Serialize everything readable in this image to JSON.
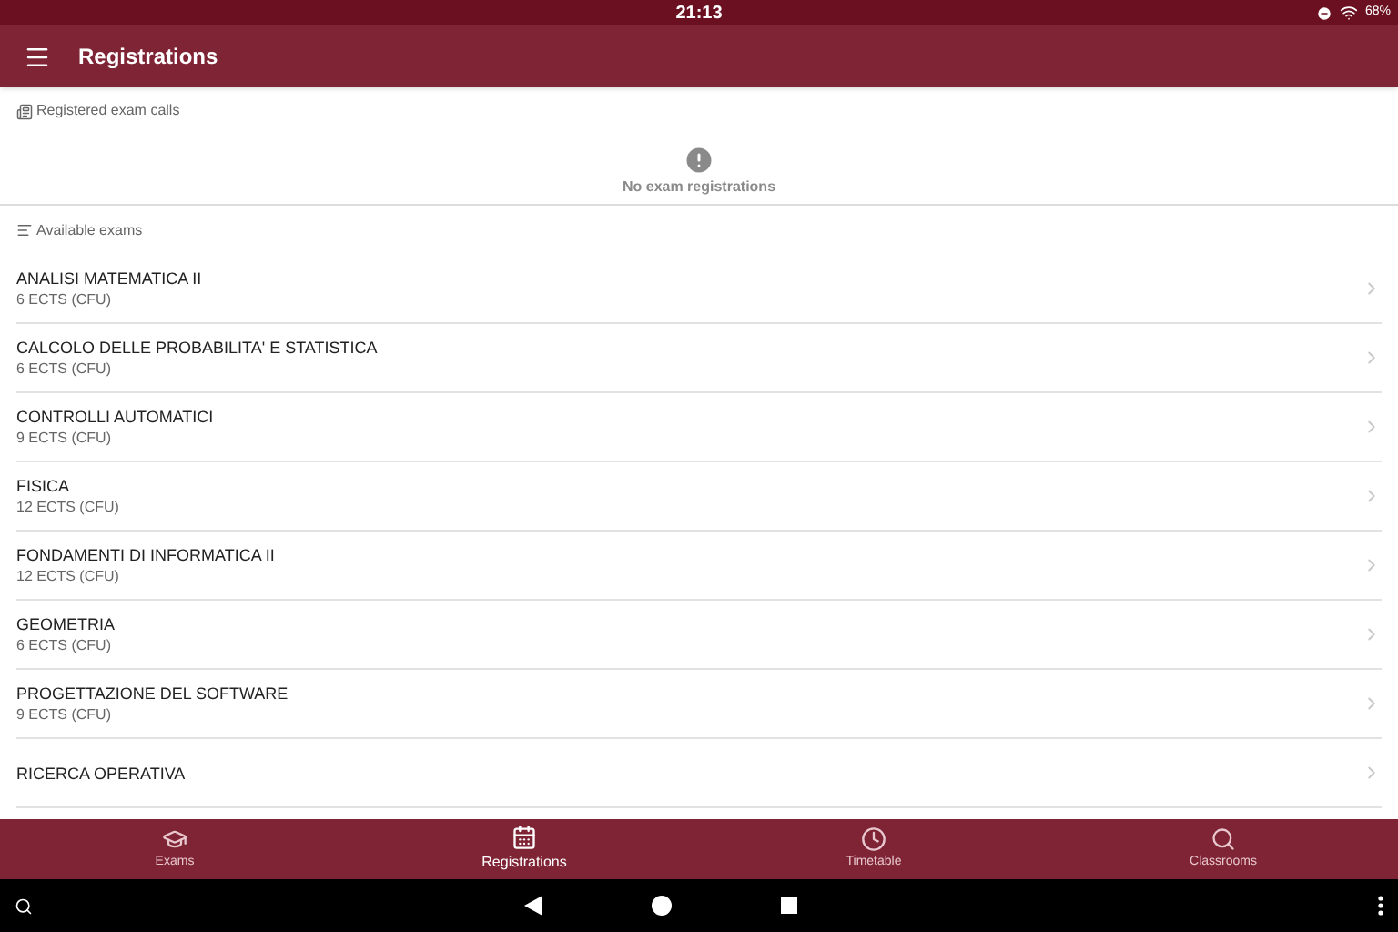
{
  "status_bar": {
    "time": "21:13",
    "battery": "68%"
  },
  "app_bar": {
    "title": "Registrations"
  },
  "registered_section": {
    "title": "Registered exam calls",
    "empty_message": "No exam registrations"
  },
  "available_section": {
    "title": "Available exams"
  },
  "exams": [
    {
      "name": "ANALISI MATEMATICA II",
      "credits": "6 ECTS (CFU)"
    },
    {
      "name": "CALCOLO DELLE PROBABILITA' E STATISTICA",
      "credits": "6 ECTS (CFU)"
    },
    {
      "name": "CONTROLLI AUTOMATICI",
      "credits": "9 ECTS (CFU)"
    },
    {
      "name": "FISICA",
      "credits": "12 ECTS (CFU)"
    },
    {
      "name": "FONDAMENTI DI INFORMATICA II",
      "credits": "12 ECTS (CFU)"
    },
    {
      "name": "GEOMETRIA",
      "credits": "6 ECTS (CFU)"
    },
    {
      "name": "PROGETTAZIONE DEL SOFTWARE",
      "credits": "9 ECTS (CFU)"
    },
    {
      "name": "RICERCA OPERATIVA"
    }
  ],
  "bottom_nav": [
    {
      "kind": "exams",
      "label": "Exams",
      "selected": false
    },
    {
      "kind": "registrations",
      "label": "Registrations",
      "selected": true
    },
    {
      "kind": "timetable",
      "label": "Timetable",
      "selected": false
    },
    {
      "kind": "classrooms",
      "label": "Classrooms",
      "selected": false
    }
  ]
}
